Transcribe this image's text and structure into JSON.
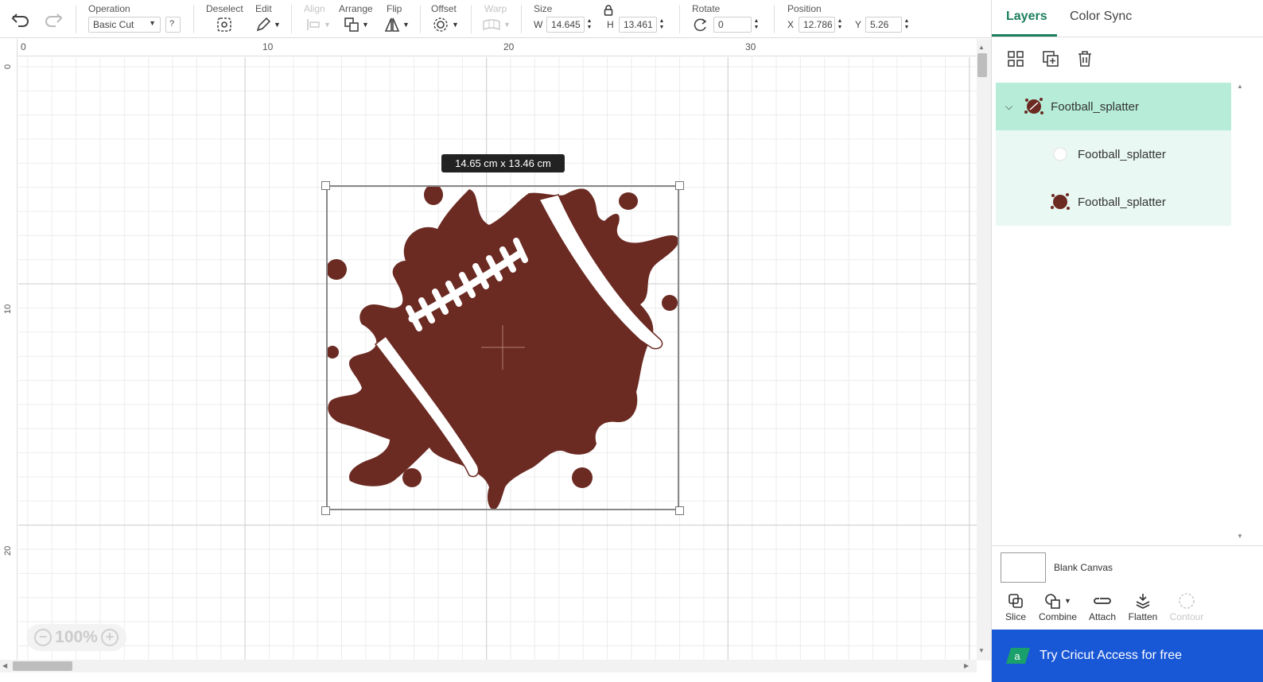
{
  "toolbar": {
    "operation": {
      "label": "Operation",
      "value": "Basic Cut",
      "help": "?"
    },
    "deselect": {
      "label": "Deselect"
    },
    "edit": {
      "label": "Edit"
    },
    "align": {
      "label": "Align"
    },
    "arrange": {
      "label": "Arrange"
    },
    "flip": {
      "label": "Flip"
    },
    "offset": {
      "label": "Offset"
    },
    "warp": {
      "label": "Warp"
    },
    "size": {
      "label": "Size",
      "w_label": "W",
      "w": "14.645",
      "h_label": "H",
      "h": "13.461"
    },
    "rotate": {
      "label": "Rotate",
      "value": "0"
    },
    "position": {
      "label": "Position",
      "x_label": "X",
      "x": "12.786",
      "y_label": "Y",
      "y": "5.26"
    }
  },
  "canvas": {
    "ruler_top": [
      "0",
      "10",
      "20",
      "30"
    ],
    "ruler_left": [
      "0",
      "10",
      "20"
    ],
    "size_tooltip": "14.65  cm x 13.46  cm",
    "zoom": "100%",
    "colors": {
      "splatter": "#6b2a22",
      "laces": "#ffffff"
    }
  },
  "panel": {
    "tabs": {
      "layers": "Layers",
      "color_sync": "Color Sync"
    },
    "layers": {
      "group": {
        "name": "Football_splatter"
      },
      "children": [
        {
          "name": "Football_splatter",
          "icon": "white-splatter-icon"
        },
        {
          "name": "Football_splatter",
          "icon": "brown-splatter-icon"
        }
      ]
    },
    "blank_canvas": "Blank Canvas",
    "actions": {
      "slice": "Slice",
      "combine": "Combine",
      "attach": "Attach",
      "flatten": "Flatten",
      "contour": "Contour"
    },
    "promo": "Try Cricut Access for free"
  }
}
